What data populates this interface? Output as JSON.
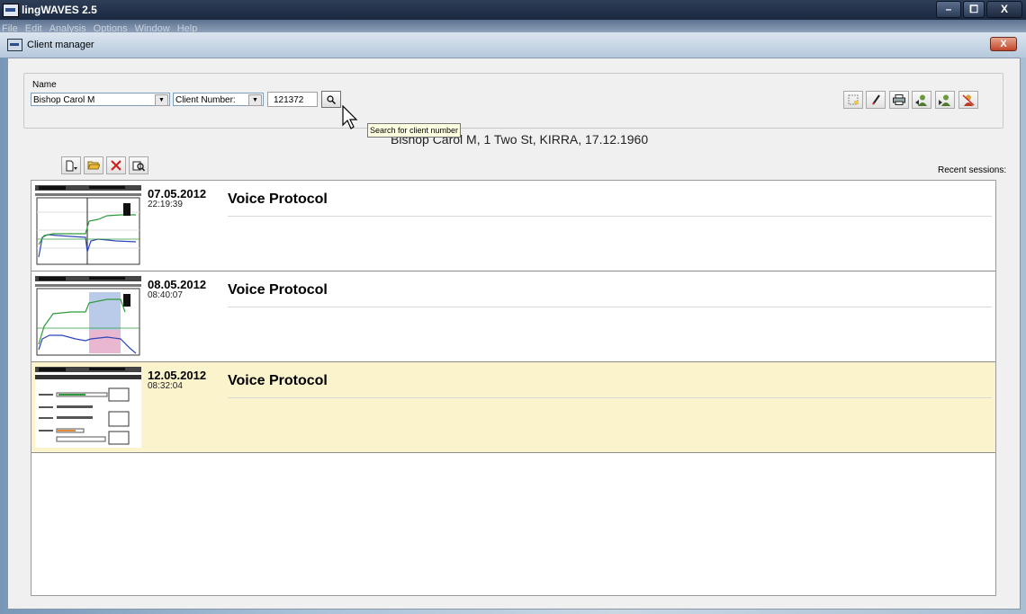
{
  "app": {
    "title": "lingWAVES 2.5",
    "minimize": "–",
    "maximize": "⧠",
    "close": "X"
  },
  "menu": [
    "File",
    "Edit",
    "Analysis",
    "Options",
    "Window",
    "Help"
  ],
  "client_window": {
    "title": "Client manager",
    "close": "X"
  },
  "header": {
    "name_label": "Name",
    "name_value": "Bishop Carol M",
    "search_by": "Client Number:",
    "number_value": "121372",
    "tooltip": "Search for client number",
    "client_info": "Bishop Carol M, 1 Two St, KIRRA, 17.12.1960"
  },
  "toolbar_right": [
    "select-icon",
    "pencil-icon",
    "printer-icon",
    "users-import-icon",
    "users-export-icon",
    "user-delete-icon"
  ],
  "toolbar_left": [
    "new-icon",
    "open-folder-icon",
    "delete-icon",
    "search-settings-icon"
  ],
  "recent_label": "Recent sessions:",
  "sessions": [
    {
      "date": "07.05.2012",
      "time": "22:19:39",
      "title": "Voice Protocol"
    },
    {
      "date": "08.05.2012",
      "time": "08:40:07",
      "title": "Voice Protocol"
    },
    {
      "date": "12.05.2012",
      "time": "08:32:04",
      "title": "Voice Protocol"
    }
  ],
  "colors": {
    "selected_row": "#fbf3cb",
    "titlebar": "#1b2940",
    "delete_icon": "#d01f1f"
  }
}
